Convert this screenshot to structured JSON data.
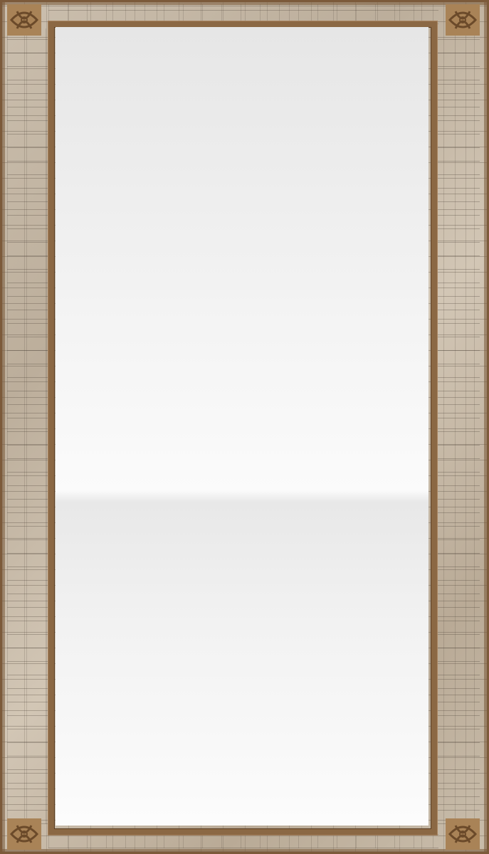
{
  "frame": {
    "material": "stone-brick",
    "trim_color": "#8b6844",
    "stone_color": "#c6b9a6",
    "mirror_color": "#f2f2f2"
  },
  "corners": [
    {
      "icon": "celtic-knot-icon"
    },
    {
      "icon": "celtic-knot-icon"
    },
    {
      "icon": "celtic-knot-icon"
    },
    {
      "icon": "celtic-knot-icon"
    }
  ]
}
